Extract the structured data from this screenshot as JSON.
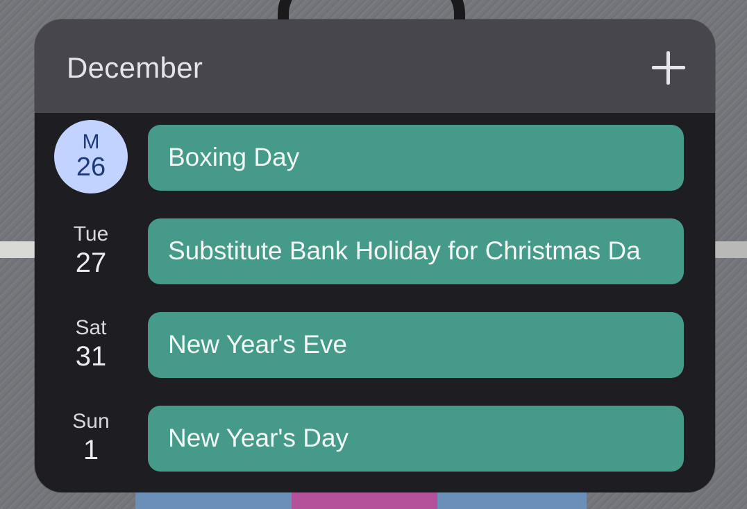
{
  "header": {
    "month": "December",
    "add_icon": "plus-icon"
  },
  "days": [
    {
      "dow": "M",
      "dom": "26",
      "today": true,
      "event": "Boxing Day"
    },
    {
      "dow": "Tue",
      "dom": "27",
      "today": false,
      "event": "Substitute Bank Holiday for Christmas Da"
    },
    {
      "dow": "Sat",
      "dom": "31",
      "today": false,
      "event": "New Year's Eve"
    },
    {
      "dow": "Sun",
      "dom": "1",
      "today": false,
      "event": "New Year's Day"
    }
  ],
  "colors": {
    "header_bg": "#47464c",
    "body_bg": "#1e1d21",
    "event_chip": "#469a89",
    "today_circle": "#c2d3ff",
    "today_text": "#1d3a7a"
  }
}
